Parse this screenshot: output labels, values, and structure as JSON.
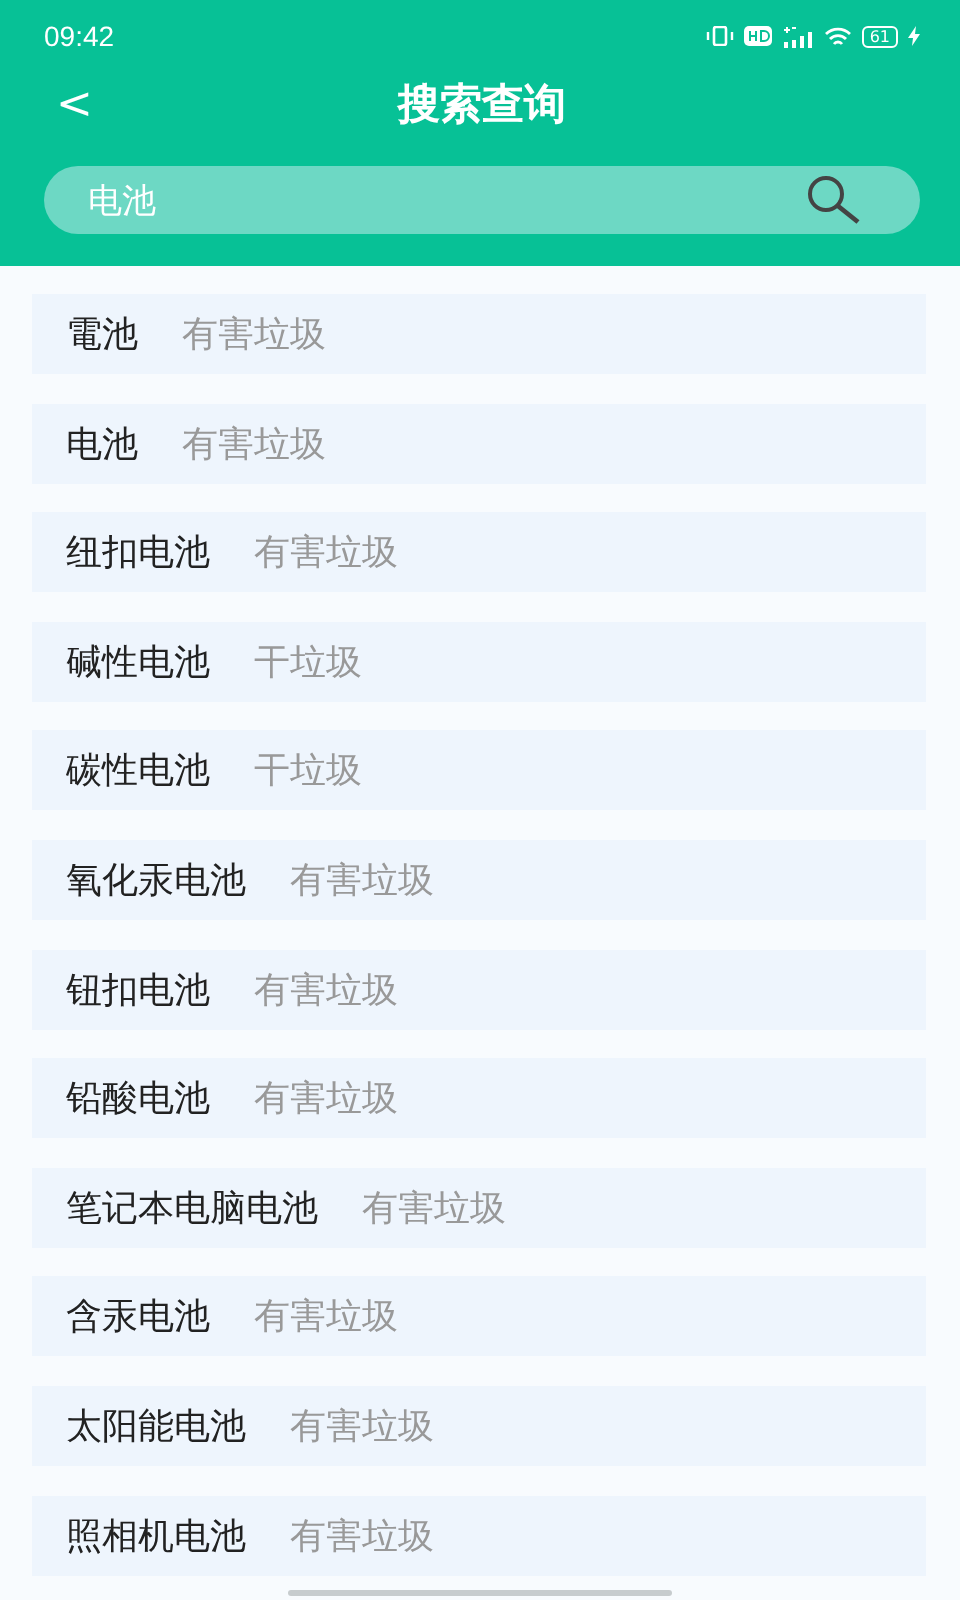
{
  "status_bar": {
    "time": "09:42",
    "battery": "61"
  },
  "header": {
    "back": "<",
    "title": "搜索查询"
  },
  "search": {
    "value": "电池"
  },
  "results": [
    {
      "name": "電池",
      "category": "有害垃圾"
    },
    {
      "name": "电池",
      "category": "有害垃圾"
    },
    {
      "name": "纽扣电池",
      "category": "有害垃圾"
    },
    {
      "name": "碱性电池",
      "category": "干垃圾"
    },
    {
      "name": "碳性电池",
      "category": "干垃圾"
    },
    {
      "name": "氧化汞电池",
      "category": "有害垃圾"
    },
    {
      "name": "钮扣电池",
      "category": "有害垃圾"
    },
    {
      "name": "铅酸电池",
      "category": "有害垃圾"
    },
    {
      "name": "笔记本电脑电池",
      "category": "有害垃圾"
    },
    {
      "name": "含汞电池",
      "category": "有害垃圾"
    },
    {
      "name": "太阳能电池",
      "category": "有害垃圾"
    },
    {
      "name": "照相机电池",
      "category": "有害垃圾"
    }
  ]
}
